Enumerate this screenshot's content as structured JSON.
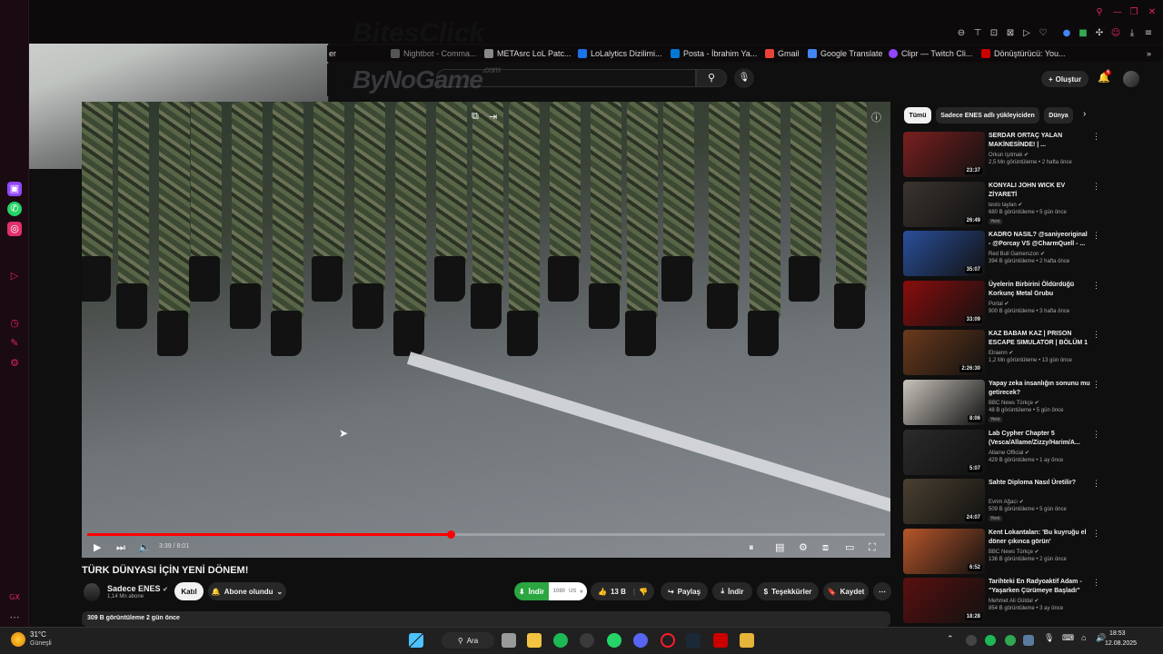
{
  "browser": {
    "bookmarks": [
      "Nightbot - Comma...",
      "METAsrc LoL Patc...",
      "LoLalytics Dizilimi...",
      "Posta - İbrahim Ya...",
      "Gmail",
      "Google Translate",
      "Clipr — Twitch Cli...",
      "Dönüştürücü: You..."
    ],
    "bookmark_prefix": "er"
  },
  "watermark": {
    "text": "ByNoGame",
    "suffix": ".com",
    "top_text": "BitesClick"
  },
  "header": {
    "create_label": "Oluştur",
    "notif_count": "6"
  },
  "video": {
    "title": "TÜRK DÜNYASI İÇİN YENİ DÖNEM!",
    "time": "3:39 / 8:01",
    "progress": 0.456,
    "channel": "Sadece ENES",
    "subscribers": "1,14 Mn abone",
    "join_label": "Katıl",
    "subscribed_label": "Abone olundu",
    "download_ext_label": "İndir",
    "quality": "1080",
    "quality_suffix": "US",
    "likes": "13 B",
    "share_label": "Paylaş",
    "download_label": "İndir",
    "thanks_label": "Teşekkürler",
    "save_label": "Kaydet",
    "views_line": "309 B görüntüleme  2 gün önce"
  },
  "chips": [
    "Tümü",
    "Sadece ENES adlı yükleyiciden",
    "Dünya"
  ],
  "recommendations": [
    {
      "title": "SERDAR ORTAÇ YALAN MAKİNESİNDE! | ...",
      "channel": "Orkun Işıtmak",
      "meta": "2,5 Mn görüntüleme • 2 hafta önce",
      "duration": "23:37",
      "is_new": false,
      "color": "#7a1f1f"
    },
    {
      "title": "KONYALI JOHN WICK EV ZİYARETİ",
      "channel": "testo taylan",
      "meta": "680 B görüntüleme • 5 gün önce",
      "duration": "26:49",
      "is_new": true,
      "color": "#3b3430"
    },
    {
      "title": "KADRO NASIL? @saniyeoriginal - @Porcay VS @CharmQuell - ...",
      "channel": "Red Bull Gamerszon",
      "meta": "394 B görüntüleme • 2 hafta önce",
      "duration": "35:07",
      "is_new": false,
      "color": "#2a4f9a"
    },
    {
      "title": "Üyelerin Birbirini Öldürdüğü Korkunç Metal Grubu",
      "channel": "Portal",
      "meta": "900 B görüntüleme • 3 hafta önce",
      "duration": "33:09",
      "is_new": false,
      "color": "#8a0d0d"
    },
    {
      "title": "KAZ BABAM KAZ | PRISON ESCAPE SIMULATOR | BÖLÜM 1",
      "channel": "Elraenn",
      "meta": "1,2 Mn görüntüleme • 13 gün önce",
      "duration": "2:26:30",
      "is_new": false,
      "color": "#6b3a1c"
    },
    {
      "title": "Yapay zeka insanlığın sonunu mu getirecek?",
      "channel": "BBC News Türkçe",
      "meta": "48 B görüntüleme • 5 gün önce",
      "duration": "8:06",
      "is_new": true,
      "color": "#c9c4bc"
    },
    {
      "title": "Lab Cypher Chapter 5 (Vesca/Allame/Zizzy/Harim/A...",
      "channel": "Allame Official",
      "meta": "429 B görüntüleme • 1 ay önce",
      "duration": "5:07",
      "is_new": false,
      "color": "#2b2b2b"
    },
    {
      "title": "Sahte Diploma Nasıl Üretilir?",
      "channel": "Evrim Ağacı",
      "meta": "509 B görüntüleme • 5 gün önce",
      "duration": "24:07",
      "is_new": true,
      "color": "#4a4030"
    },
    {
      "title": "Kent Lokantaları: 'Bu kuyruğu el döner çıkınca görün'",
      "channel": "BBC News Türkçe",
      "meta": "136 B görüntüleme • 2 gün önce",
      "duration": "6:52",
      "is_new": false,
      "color": "#b8562a"
    },
    {
      "title": "Tarihteki En Radyoaktif Adam - \"Yaşarken Çürümeye Başladı\"",
      "channel": "Mehmet Ali Güldal",
      "meta": "854 B görüntüleme • 3 ay önce",
      "duration": "18:28",
      "is_new": false,
      "color": "#5a1010"
    }
  ],
  "taskbar": {
    "temperature": "31°C",
    "weather": "Güneşli",
    "search_label": "Ara",
    "time": "18:53",
    "date": "12.08.2025"
  },
  "colors": {
    "accent": "#ff0000",
    "download_green": "#2ba640"
  }
}
